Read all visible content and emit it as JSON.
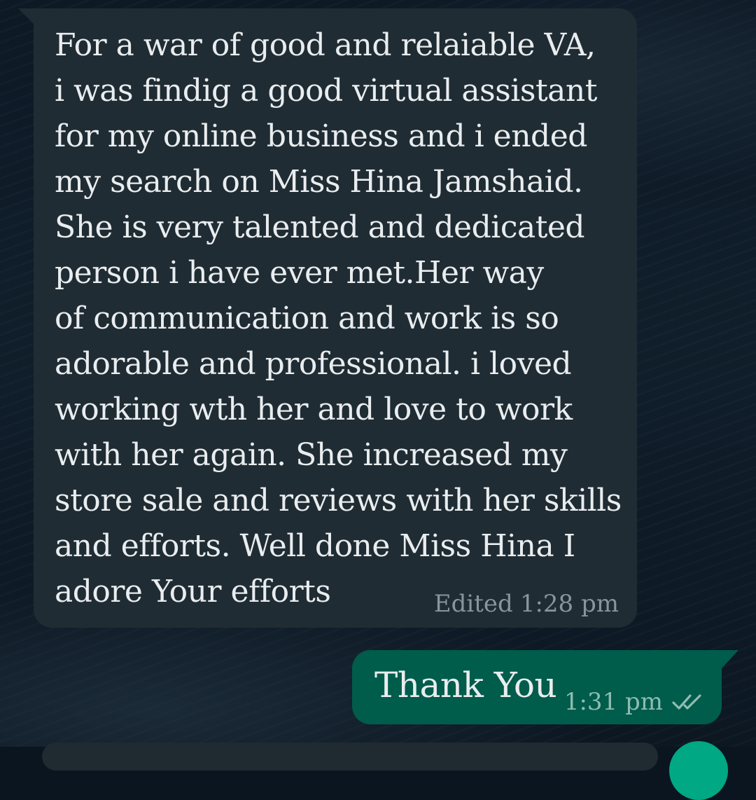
{
  "conversation": {
    "incoming": {
      "text": "For a war of good and relaiable VA,\ni was findig a good virtual assistant\nfor my online business and i ended\nmy search on Miss Hina Jamshaid.\nShe is very talented and dedicated\nperson i have ever met.Her way\nof communication and work is so\nadorable and professional. i loved\nworking wth her and love to work\nwith her again. She increased my\nstore sale and reviews with her skills\nand efforts. Well done Miss Hina I\nadore Your efforts",
      "edited_label": "Edited",
      "time": "1:28 pm"
    },
    "outgoing": {
      "text": "Thank You",
      "time": "1:31 pm",
      "status_icon": "double-check-icon"
    }
  },
  "colors": {
    "incoming_bubble": "#202c33",
    "outgoing_bubble": "#005c4b",
    "message_text": "#e9edef",
    "meta_text_incoming": "#8696a0",
    "meta_text_outgoing": "#8fbcb1",
    "read_ticks": "#8fbcb1"
  }
}
